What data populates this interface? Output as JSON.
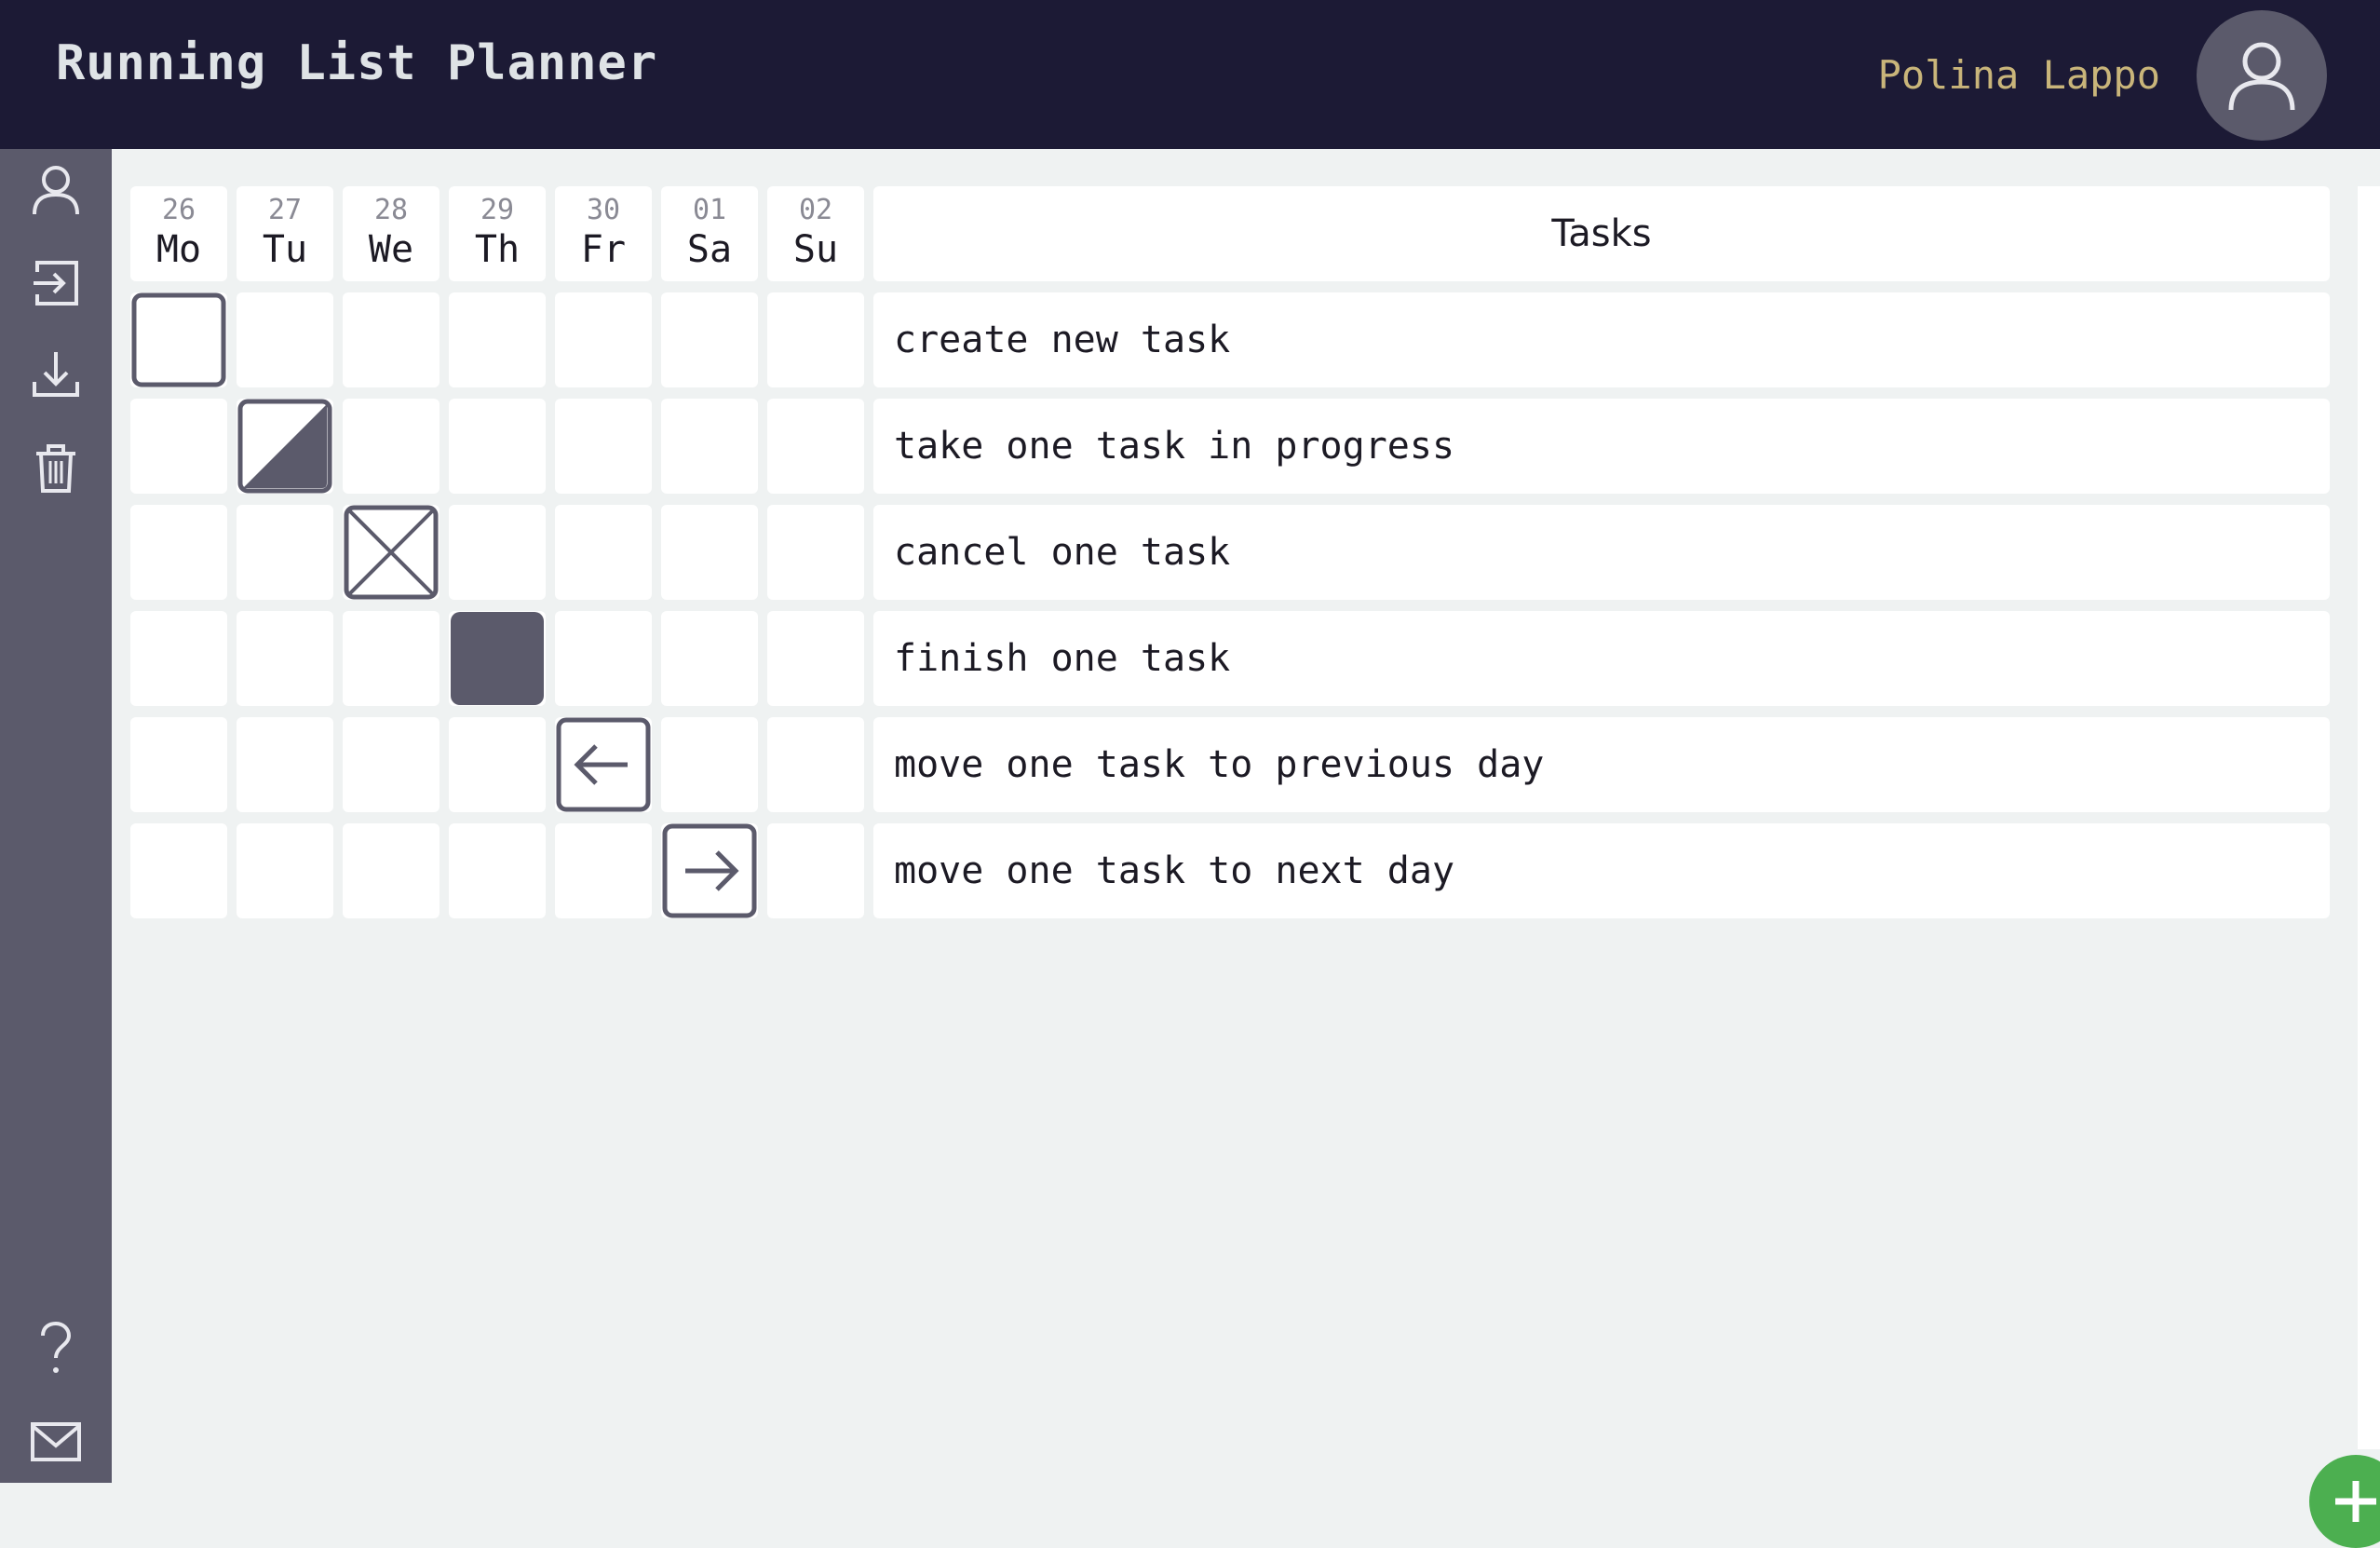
{
  "header": {
    "title": "Running List Planner",
    "user_name": "Polina Lappo",
    "avatar_icon": "user-icon"
  },
  "sidebar": {
    "items": [
      {
        "icon": "user-icon"
      },
      {
        "icon": "login-icon"
      },
      {
        "icon": "download-icon"
      },
      {
        "icon": "trash-icon"
      },
      {
        "icon": "help-icon"
      },
      {
        "icon": "mail-icon"
      }
    ]
  },
  "days": [
    {
      "num": "26",
      "name": "Mo"
    },
    {
      "num": "27",
      "name": "Tu"
    },
    {
      "num": "28",
      "name": "We"
    },
    {
      "num": "29",
      "name": "Th"
    },
    {
      "num": "30",
      "name": "Fr"
    },
    {
      "num": "01",
      "name": "Sa"
    },
    {
      "num": "02",
      "name": "Su"
    }
  ],
  "tasks_header": "Tasks",
  "tasks": [
    {
      "text": "create new task",
      "day": "Mo",
      "status": "new"
    },
    {
      "text": "take one task in progress",
      "day": "Tu",
      "status": "in-progress"
    },
    {
      "text": "cancel one task",
      "day": "We",
      "status": "cancelled"
    },
    {
      "text": "finish one task",
      "day": "Th",
      "status": "done"
    },
    {
      "text": "move one task to previous day",
      "day": "Fr",
      "status": "moved-previous"
    },
    {
      "text": "move one task to next day",
      "day": "Sa",
      "status": "moved-next"
    }
  ],
  "colors": {
    "header_bg": "#1c1a35",
    "sidebar_bg": "#5b5a6b",
    "user_name": "#c9b57a",
    "add_button": "#4caf50",
    "status_mark": "#5b5a6b"
  },
  "add_button_icon": "plus-icon"
}
